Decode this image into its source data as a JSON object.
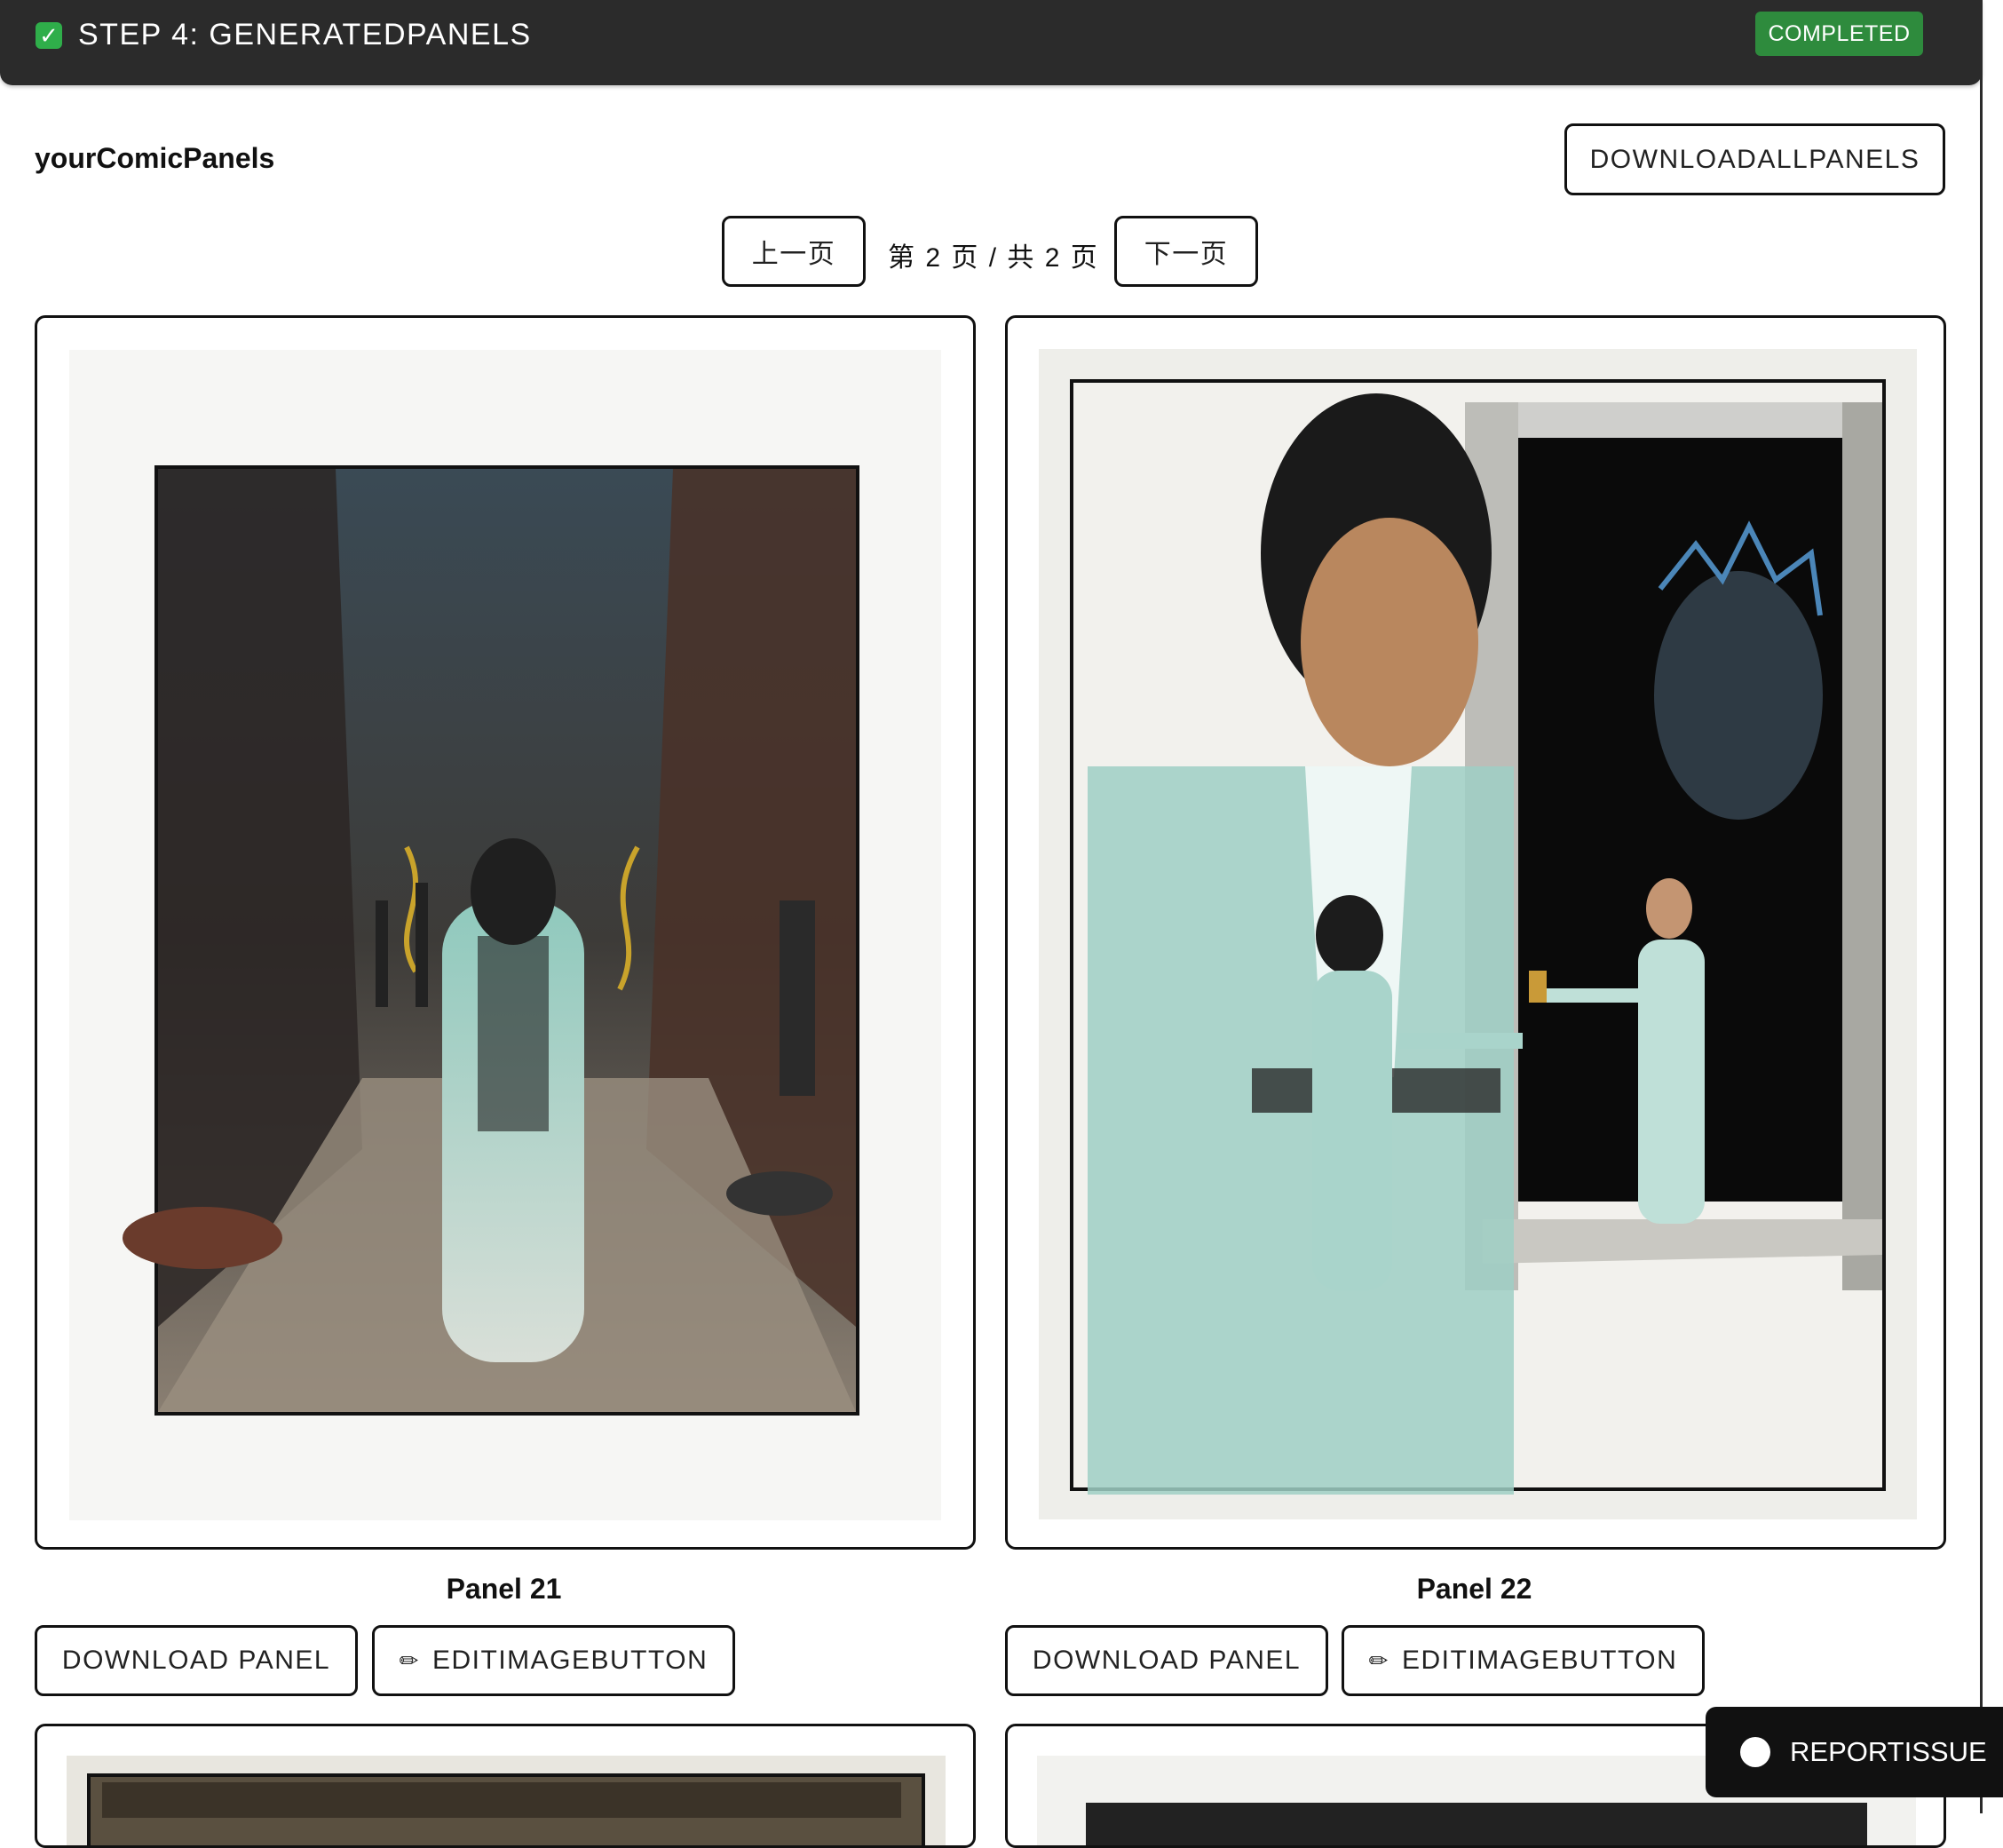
{
  "header": {
    "check_icon": "✓",
    "title": "STEP 4: GENERATEDPANELS",
    "status": "COMPLETED",
    "status_color": "#2e8b3d"
  },
  "section": {
    "title": "yourComicPanels",
    "download_all_label": "DOWNLOADALLPANELS"
  },
  "pagination": {
    "prev_label": "上一页",
    "info": "第 2 页 / 共 2 页",
    "next_label": "下一页"
  },
  "panels": [
    {
      "label": "Panel 21",
      "download_label": "DOWNLOAD PANEL",
      "edit_label": "EDITIMAGEBUTTON",
      "edit_icon": "✏"
    },
    {
      "label": "Panel 22",
      "download_label": "DOWNLOAD PANEL",
      "edit_label": "EDITIMAGEBUTTON",
      "edit_icon": "✏"
    }
  ],
  "report": {
    "label": "REPORTISSUE"
  }
}
